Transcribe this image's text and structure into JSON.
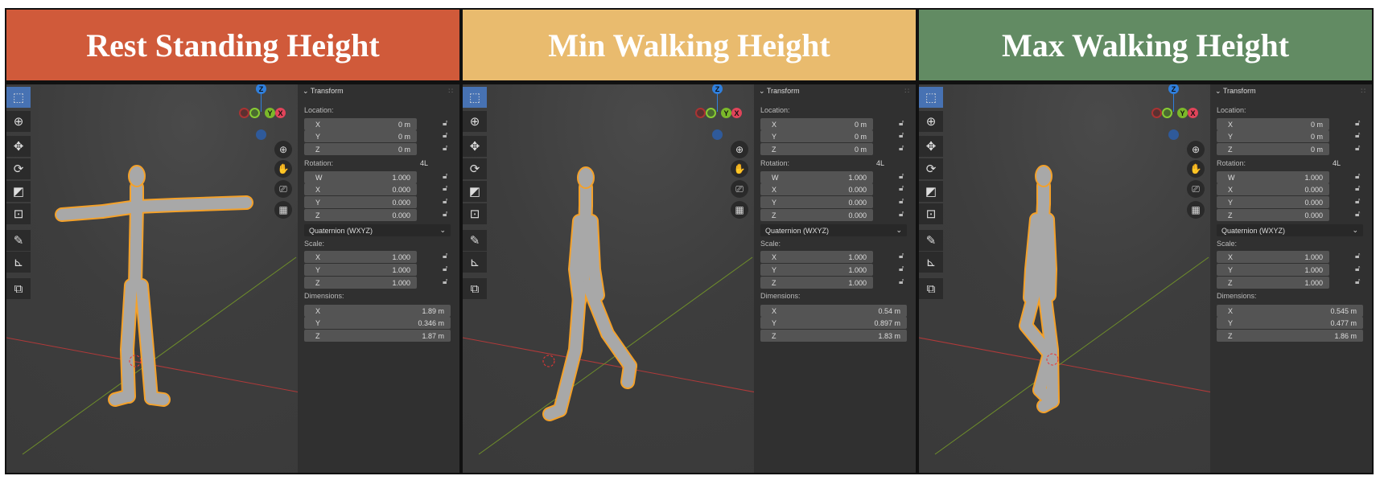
{
  "panels": [
    {
      "title": "Rest Standing Height",
      "header_color": "#d05a3a",
      "transform": {
        "header": "Transform",
        "location_label": "Location:",
        "location": [
          [
            "X",
            "0 m"
          ],
          [
            "Y",
            "0 m"
          ],
          [
            "Z",
            "0 m"
          ]
        ],
        "rotation_label": "Rotation:",
        "rotation_mode_badge": "4L",
        "rotation": [
          [
            "W",
            "1.000"
          ],
          [
            "X",
            "0.000"
          ],
          [
            "Y",
            "0.000"
          ],
          [
            "Z",
            "0.000"
          ]
        ],
        "rotation_mode": "Quaternion (WXYZ)",
        "scale_label": "Scale:",
        "scale": [
          [
            "X",
            "1.000"
          ],
          [
            "Y",
            "1.000"
          ],
          [
            "Z",
            "1.000"
          ]
        ],
        "dimensions_label": "Dimensions:",
        "dimensions": [
          [
            "X",
            "1.89 m"
          ],
          [
            "Y",
            "0.346 m"
          ],
          [
            "Z",
            "1.87 m"
          ]
        ]
      }
    },
    {
      "title": "Min Walking Height",
      "header_color": "#e9bb6e",
      "transform": {
        "header": "Transform",
        "location_label": "Location:",
        "location": [
          [
            "X",
            "0 m"
          ],
          [
            "Y",
            "0 m"
          ],
          [
            "Z",
            "0 m"
          ]
        ],
        "rotation_label": "Rotation:",
        "rotation_mode_badge": "4L",
        "rotation": [
          [
            "W",
            "1.000"
          ],
          [
            "X",
            "0.000"
          ],
          [
            "Y",
            "0.000"
          ],
          [
            "Z",
            "0.000"
          ]
        ],
        "rotation_mode": "Quaternion (WXYZ)",
        "scale_label": "Scale:",
        "scale": [
          [
            "X",
            "1.000"
          ],
          [
            "Y",
            "1.000"
          ],
          [
            "Z",
            "1.000"
          ]
        ],
        "dimensions_label": "Dimensions:",
        "dimensions": [
          [
            "X",
            "0.54 m"
          ],
          [
            "Y",
            "0.897 m"
          ],
          [
            "Z",
            "1.83 m"
          ]
        ]
      }
    },
    {
      "title": "Max Walking Height",
      "header_color": "#628b63",
      "transform": {
        "header": "Transform",
        "location_label": "Location:",
        "location": [
          [
            "X",
            "0 m"
          ],
          [
            "Y",
            "0 m"
          ],
          [
            "Z",
            "0 m"
          ]
        ],
        "rotation_label": "Rotation:",
        "rotation_mode_badge": "4L",
        "rotation": [
          [
            "W",
            "1.000"
          ],
          [
            "X",
            "0.000"
          ],
          [
            "Y",
            "0.000"
          ],
          [
            "Z",
            "0.000"
          ]
        ],
        "rotation_mode": "Quaternion (WXYZ)",
        "scale_label": "Scale:",
        "scale": [
          [
            "X",
            "1.000"
          ],
          [
            "Y",
            "1.000"
          ],
          [
            "Z",
            "1.000"
          ]
        ],
        "dimensions_label": "Dimensions:",
        "dimensions": [
          [
            "X",
            "0.545 m"
          ],
          [
            "Y",
            "0.477 m"
          ],
          [
            "Z",
            "1.86 m"
          ]
        ]
      }
    }
  ],
  "gizmo": {
    "z": "Z",
    "y": "Y",
    "x": "X"
  },
  "toolbar_icons": [
    "select-box-icon",
    "cursor-icon",
    "move-icon",
    "rotate-icon",
    "scale-icon",
    "transform-icon",
    "annotate-icon",
    "measure-icon",
    "add-cube-icon"
  ],
  "nav_icons": [
    "zoom-icon",
    "pan-hand-icon",
    "camera-icon",
    "grid-view-icon"
  ],
  "colors": {
    "outline": "#f4a12a",
    "mesh": "#a8a8a8",
    "active_tool": "#4772b3",
    "x_axis": "#e0445a",
    "y_axis": "#7bb82a",
    "z_axis": "#2f7fdd"
  }
}
